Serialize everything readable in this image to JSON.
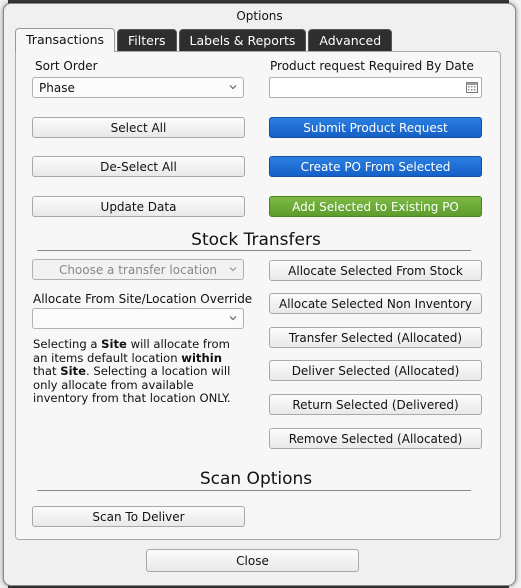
{
  "dialog": {
    "title": "Options"
  },
  "tabs": [
    {
      "label": "Transactions",
      "active": true
    },
    {
      "label": "Filters",
      "active": false
    },
    {
      "label": "Labels & Reports",
      "active": false
    },
    {
      "label": "Advanced",
      "active": false
    }
  ],
  "sort": {
    "label": "Sort Order",
    "value": "Phase"
  },
  "product_request": {
    "label": "Product request Required By Date",
    "value": ""
  },
  "buttons": {
    "select_all": "Select All",
    "deselect_all": "De-Select All",
    "update_data": "Update Data",
    "submit_request": "Submit Product Request",
    "create_po": "Create PO From Selected",
    "add_to_po": "Add Selected to Existing PO"
  },
  "stock_transfers": {
    "heading": "Stock Transfers",
    "location_placeholder": "Choose a transfer location",
    "override_label": "Allocate From Site/Location Override",
    "override_value": "",
    "desc_1": "Selecting a ",
    "desc_site": "Site",
    "desc_2": " will allocate from an items default location ",
    "desc_within": "within",
    "desc_3": " that ",
    "desc_site2": "Site",
    "desc_4": ". Selecting a location will only allocate from available inventory from that location ONLY.",
    "allocate_from_stock": "Allocate Selected From Stock",
    "allocate_non_inventory": "Allocate Selected Non Inventory",
    "transfer_selected": "Transfer Selected (Allocated)",
    "deliver_selected": "Deliver Selected (Allocated)",
    "return_selected": "Return Selected (Delivered)",
    "remove_selected": "Remove Selected (Allocated)"
  },
  "scan": {
    "heading": "Scan Options",
    "scan_to_deliver": "Scan To Deliver"
  },
  "footer": {
    "close": "Close"
  },
  "colors": {
    "accent_blue": "#1d6fd6",
    "accent_green": "#6aaa36"
  }
}
